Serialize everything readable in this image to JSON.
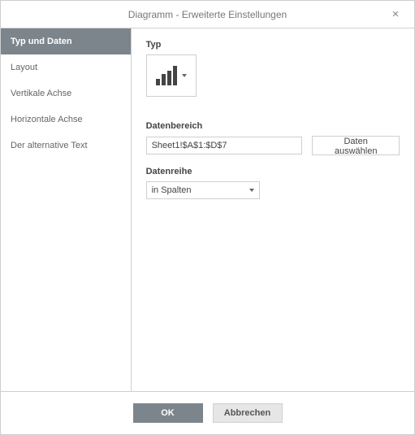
{
  "dialog": {
    "title": "Diagramm - Erweiterte Einstellungen"
  },
  "sidebar": {
    "items": [
      {
        "label": "Typ und Daten",
        "active": true
      },
      {
        "label": "Layout",
        "active": false
      },
      {
        "label": "Vertikale Achse",
        "active": false
      },
      {
        "label": "Horizontale Achse",
        "active": false
      },
      {
        "label": "Der alternative Text",
        "active": false
      }
    ]
  },
  "content": {
    "type_label": "Typ",
    "chart_type_icon": "column-chart-icon",
    "data_range_label": "Datenbereich",
    "data_range_value": "Sheet1!$A$1:$D$7",
    "select_data_button": "Daten auswählen",
    "data_series_label": "Datenreihe",
    "data_series_value": "in Spalten"
  },
  "footer": {
    "ok": "OK",
    "cancel": "Abbrechen"
  }
}
